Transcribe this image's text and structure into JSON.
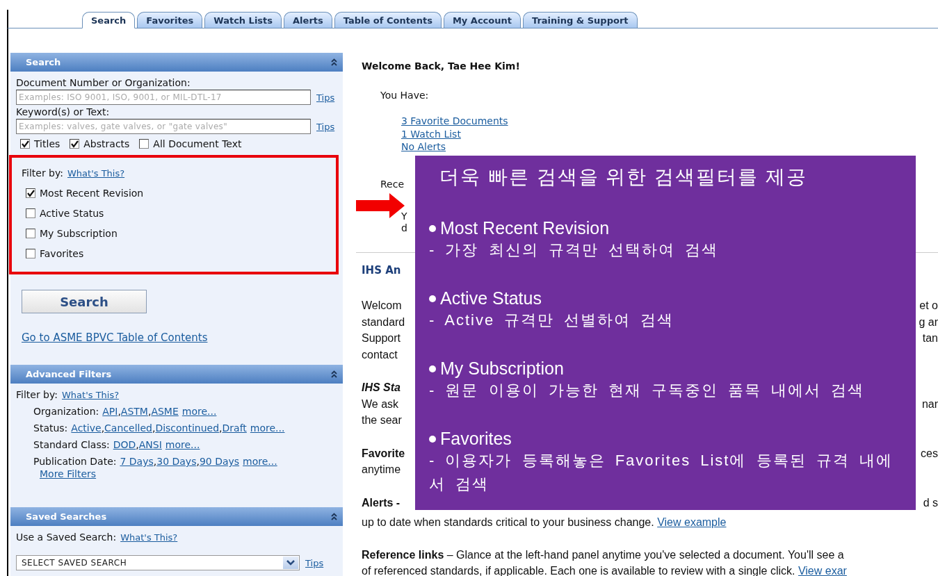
{
  "tabs": [
    {
      "label": "Search",
      "selected": true
    },
    {
      "label": "Favorites",
      "selected": false
    },
    {
      "label": "Watch Lists",
      "selected": false
    },
    {
      "label": "Alerts",
      "selected": false
    },
    {
      "label": "Table of Contents",
      "selected": false
    },
    {
      "label": "My Account",
      "selected": false
    },
    {
      "label": "Training & Support",
      "selected": false
    }
  ],
  "search_panel": {
    "title": "Search",
    "fields": [
      {
        "label": "Document Number or Organization:",
        "placeholder": "Examples: ISO 9001, ISO, 9001, or MIL-DTL-17",
        "tips": "Tips"
      },
      {
        "label": "Keyword(s) or Text:",
        "placeholder": "Examples: valves, gate valves, or \"gate valves\"",
        "tips": "Tips"
      }
    ],
    "scope": [
      {
        "label": "Titles",
        "checked": true
      },
      {
        "label": "Abstracts",
        "checked": true
      },
      {
        "label": "All Document Text",
        "checked": false
      }
    ],
    "filter": {
      "label": "Filter by:",
      "help": "What's This?",
      "options": [
        {
          "label": "Most Recent Revision",
          "checked": true
        },
        {
          "label": "Active Status",
          "checked": false
        },
        {
          "label": "My Subscription",
          "checked": false
        },
        {
          "label": "Favorites",
          "checked": false
        }
      ]
    },
    "button": "Search",
    "toc_link": "Go to ASME BPVC Table of Contents"
  },
  "advanced": {
    "title": "Advanced Filters",
    "label": "Filter by:",
    "help": "What's This?",
    "separator": ",",
    "rows": [
      {
        "label": "Organization:",
        "links": [
          "API",
          "ASTM",
          "ASME"
        ],
        "more": "more..."
      },
      {
        "label": "Status:",
        "links": [
          "Active",
          "Cancelled",
          "Discontinued",
          "Draft"
        ],
        "more": "more..."
      },
      {
        "label": "Standard Class:",
        "links": [
          "DOD",
          "ANSI"
        ],
        "more": "more..."
      },
      {
        "label": "Publication Date:",
        "links": [
          "7 Days",
          "30 Days",
          "90 Days"
        ],
        "more": "more..."
      }
    ],
    "more_filters": "More Filters"
  },
  "saved": {
    "title": "Saved Searches",
    "label": "Use a Saved Search:",
    "help": "What's This?",
    "select": "SELECT SAVED SEARCH",
    "tips": "Tips"
  },
  "main": {
    "greeting": "Welcome Back, Tae Hee Kim!",
    "you_have": "You Have:",
    "links": [
      "3 Favorite Documents",
      "1 Watch List",
      "No Alerts"
    ],
    "recent": "Rece",
    "recent_lines": [
      "Y",
      "d"
    ],
    "section_title": "IHS An",
    "paragraphs": [
      {
        "lines": [
          {
            "left": "Welcom",
            "right": "et o",
            "kind": "plain"
          },
          {
            "left": "standard",
            "right": "g ar",
            "kind": "plain"
          },
          {
            "left": "Support",
            "right": "tan",
            "kind": "plain"
          },
          {
            "left": "contact",
            "kind": "plain"
          }
        ]
      },
      {
        "lines": [
          {
            "left": "IHS Sta",
            "kind": "heading"
          },
          {
            "left": "We ask",
            "right": "nar",
            "kind": "plain"
          },
          {
            "left": "the sear",
            "kind": "plain"
          }
        ]
      },
      {
        "lines": [
          {
            "left": "Favorite",
            "right": "ces",
            "kind": "bold"
          },
          {
            "left": "anytime",
            "kind": "plain"
          }
        ]
      },
      {
        "lines": [
          {
            "left": "Alerts -",
            "right": "d s",
            "kind": "bold"
          }
        ]
      }
    ],
    "alerts_tail": "up to date when standards critical to your business change.",
    "alerts_link": "View example",
    "reference_line": "**Reference links** – Glance at the left-hand panel anytime you've selected a document. You'll see a",
    "reference_line2": "of referenced standards, if applicable. Each one is available to review with a single click.",
    "reference_link": "View exar"
  },
  "overlay": {
    "title": "더욱 빠른 검색을 위한 검색필터를 제공",
    "items": [
      {
        "heading": "Most Recent Revision",
        "desc": "- 가장 최신의 규격만 선택하여 검색"
      },
      {
        "heading": "Active Status",
        "desc": "- Active 규격만 선별하여 검색"
      },
      {
        "heading": "My Subscription",
        "desc": "- 원문 이용이 가능한 현재 구독중인 품목 내에서 검색"
      },
      {
        "heading": "Favorites",
        "desc": "- 이용자가 등록해놓은 Favorites List에 등록된 규격 내에서 검색"
      }
    ]
  }
}
